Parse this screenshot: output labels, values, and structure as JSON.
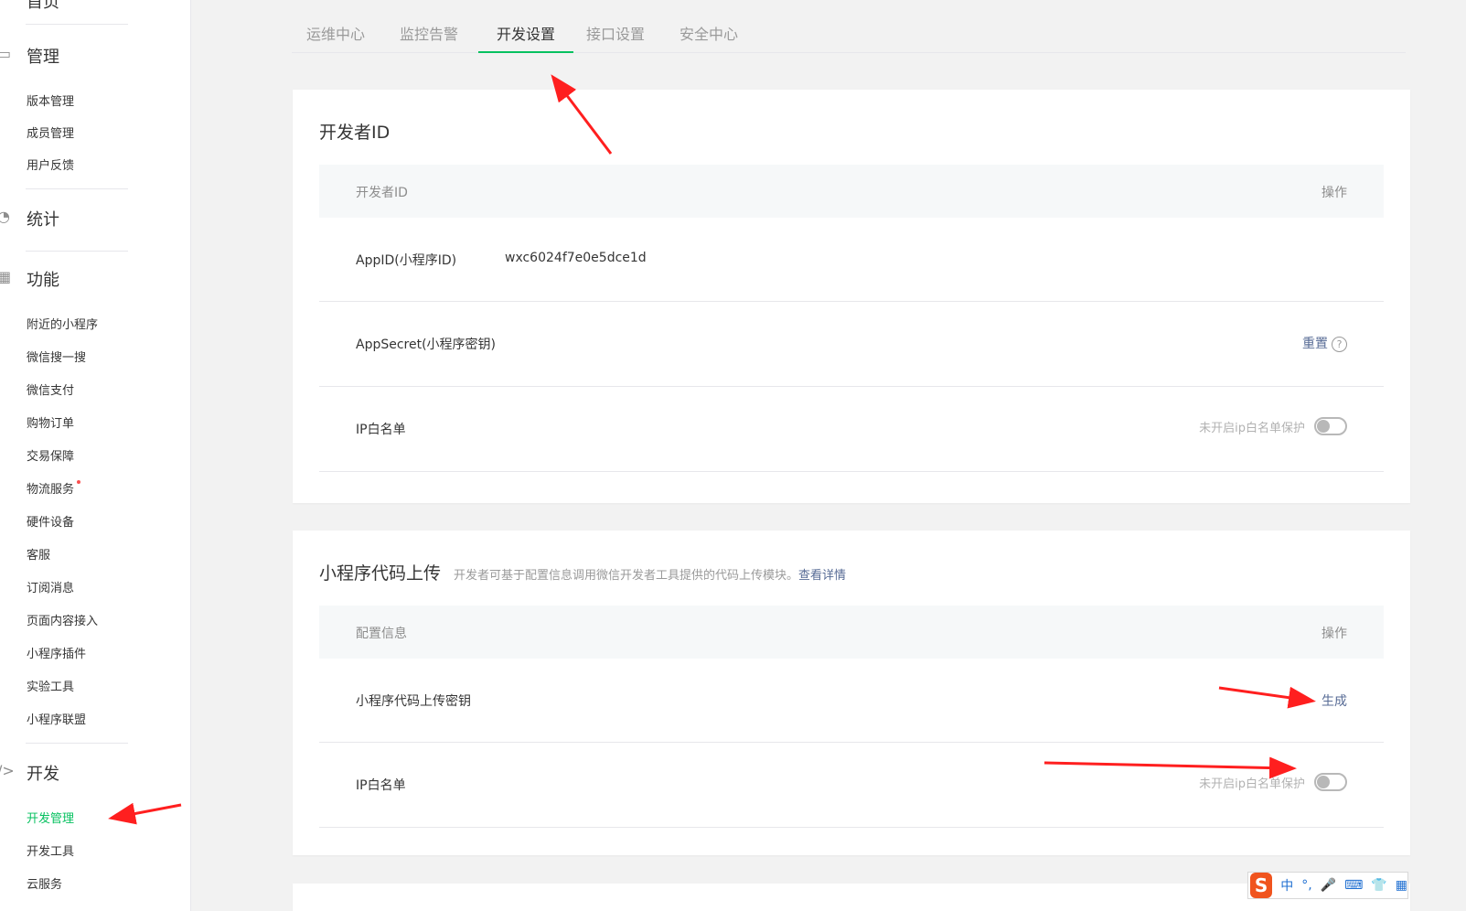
{
  "sidebar": {
    "partial_top": "首页",
    "sections": [
      {
        "title": "管理",
        "icon": "folder-icon",
        "items": [
          "版本管理",
          "成员管理",
          "用户反馈"
        ]
      },
      {
        "title": "统计",
        "icon": "pie-chart-icon",
        "items": []
      },
      {
        "title": "功能",
        "icon": "grid-icon",
        "items": [
          "附近的小程序",
          "微信搜一搜",
          "微信支付",
          "购物订单",
          "交易保障",
          "物流服务",
          "硬件设备",
          "客服",
          "订阅消息",
          "页面内容接入",
          "小程序插件",
          "实验工具",
          "小程序联盟"
        ]
      },
      {
        "title": "开发",
        "icon": "code-icon",
        "items": [
          "开发管理",
          "开发工具",
          "云服务"
        ]
      }
    ],
    "active_item": "开发管理"
  },
  "tabs": [
    "运维中心",
    "监控告警",
    "开发设置",
    "接口设置",
    "安全中心"
  ],
  "active_tab": "开发设置",
  "developer_id": {
    "title": "开发者ID",
    "header": {
      "col1": "开发者ID",
      "col2": "操作"
    },
    "rows": {
      "appid_label": "AppID(小程序ID)",
      "appid_value": "wxc6024f7e0e5dce1d",
      "secret_label": "AppSecret(小程序密钥)",
      "secret_action": "重置",
      "ip_label": "IP白名单",
      "ip_status": "未开启ip白名单保护"
    }
  },
  "code_upload": {
    "title": "小程序代码上传",
    "desc": "开发者可基于配置信息调用微信开发者工具提供的代码上传模块。",
    "desc_link": "查看详情",
    "header": {
      "col1": "配置信息",
      "col2": "操作"
    },
    "rows": {
      "key_label": "小程序代码上传密钥",
      "key_action": "生成",
      "ip_label": "IP白名单",
      "ip_status": "未开启ip白名单保护"
    }
  },
  "ime": {
    "logo": "S",
    "items": [
      "中",
      "°,",
      "🎤",
      "⌨",
      "👕",
      "▦"
    ]
  },
  "colors": {
    "accent": "#07c160",
    "link": "#576b95",
    "annotation": "#ff1f1f"
  }
}
